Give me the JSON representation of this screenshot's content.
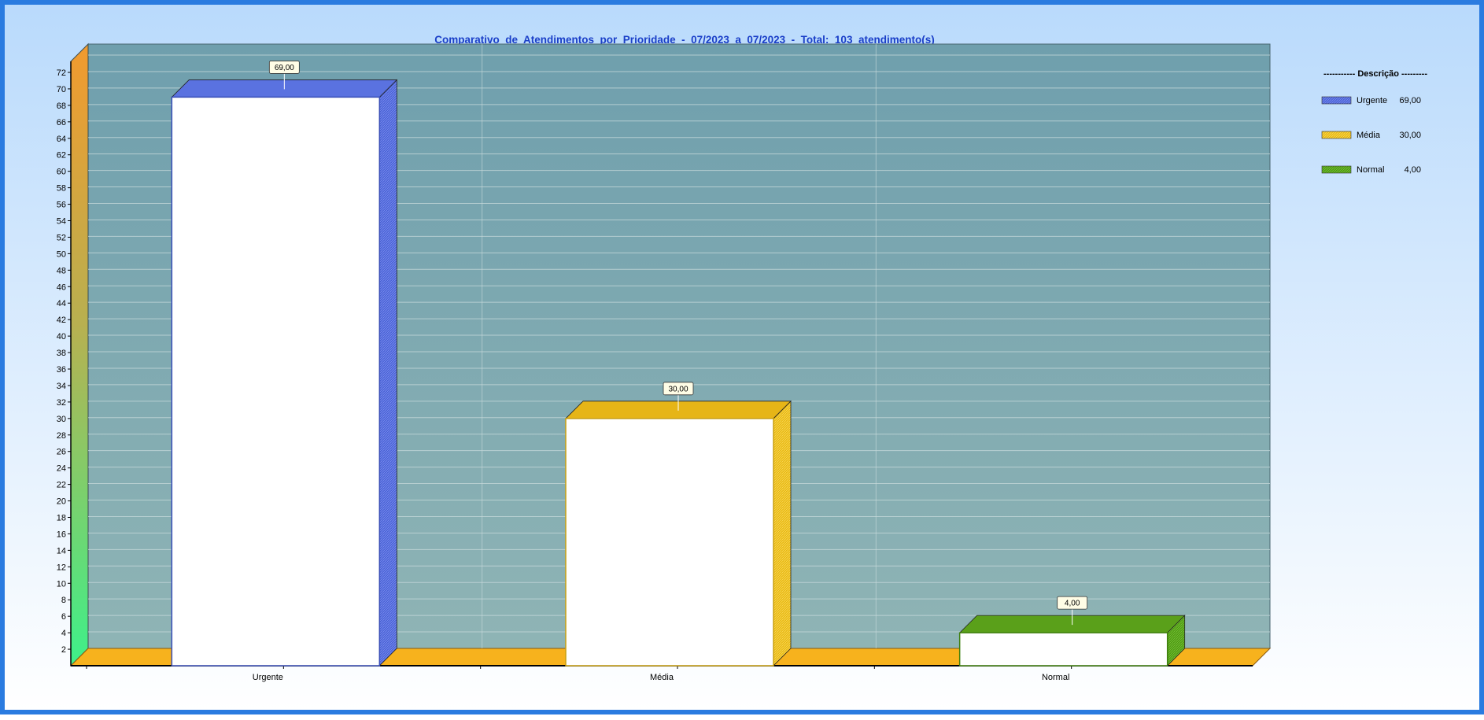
{
  "chart_data": {
    "type": "bar",
    "title": "Comparativo  de  Atendimentos  por  Prioridade  -  07/2023  a  07/2023  -  Total:  103  atendimento(s)",
    "categories": [
      "Urgente",
      "Média",
      "Normal"
    ],
    "values": [
      69,
      30,
      4
    ],
    "value_labels": [
      "69,00",
      "30,00",
      "4,00"
    ],
    "ylim": [
      0,
      72
    ],
    "yticks": [
      2,
      4,
      6,
      8,
      10,
      12,
      14,
      16,
      18,
      20,
      22,
      24,
      26,
      28,
      30,
      32,
      34,
      36,
      38,
      40,
      42,
      44,
      46,
      48,
      50,
      52,
      54,
      56,
      58,
      60,
      62,
      64,
      66,
      68,
      70,
      72
    ],
    "xlabel": "",
    "ylabel": "",
    "grid": true,
    "three_d": true,
    "legend": {
      "placement": "top-right",
      "title": "----------- Descrição ---------",
      "entries": [
        {
          "label": "Urgente",
          "value": "69,00"
        },
        {
          "label": "Média",
          "value": "30,00"
        },
        {
          "label": "Normal",
          "value": "4,00"
        }
      ]
    },
    "colors": {
      "series": [
        "#4a63d6",
        "#f2c21a",
        "#4e9a12"
      ],
      "plot_background": "#7fa8b0",
      "floor": "#f7b21d",
      "frame_border": "#2a7be0",
      "title": "#1a3fc8"
    }
  }
}
